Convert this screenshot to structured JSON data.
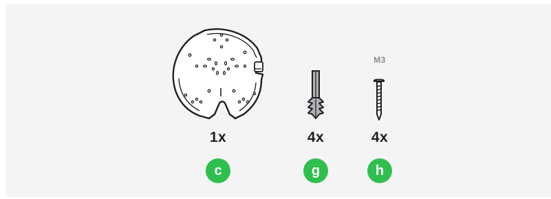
{
  "accent_color": "#2fbf4f",
  "parts": [
    {
      "name": "mounting-plate",
      "icon": "mounting-plate-icon",
      "quantity": "1x",
      "letter": "c",
      "size_label": ""
    },
    {
      "name": "wall-anchor",
      "icon": "wall-anchor-icon",
      "quantity": "4x",
      "letter": "g",
      "size_label": ""
    },
    {
      "name": "screw",
      "icon": "screw-icon",
      "quantity": "4x",
      "letter": "h",
      "size_label": "M3"
    }
  ]
}
